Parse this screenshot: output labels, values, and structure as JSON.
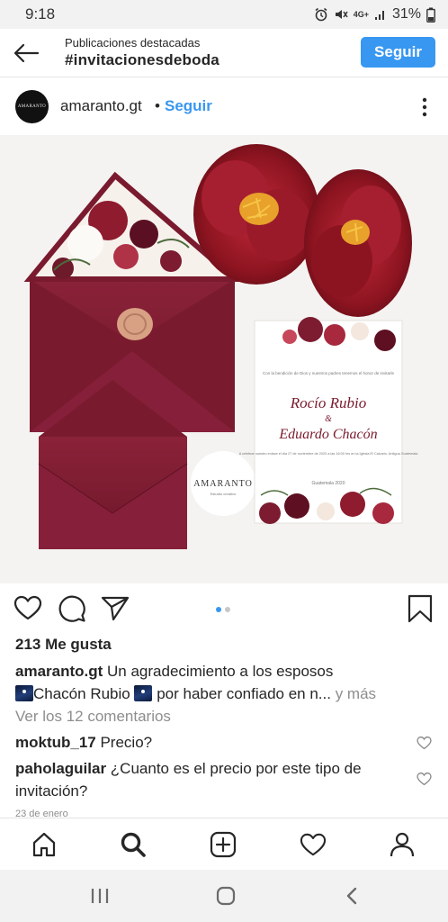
{
  "status_bar": {
    "time": "9:18",
    "network": "4G+",
    "battery": "31%",
    "icons": [
      "alarm-icon",
      "mute-icon",
      "signal-icon",
      "battery-icon"
    ]
  },
  "header": {
    "subtitle": "Publicaciones destacadas",
    "title": "#invitacionesdeboda",
    "follow_label": "Seguir"
  },
  "post": {
    "avatar_text": "AMARANTO",
    "username": "amaranto.gt",
    "separator": "•",
    "follow_label": "Seguir",
    "image": {
      "brand": "AMARANTO",
      "brand_sub": "Estudio creativo",
      "card_intro": "Con la bendición de Dios y nuestros padres tenemos el honor de invitarle",
      "name1": "Rocío Rubio",
      "ampersand": "&",
      "name2": "Eduardo Chacón",
      "card_details": "A celebrar nuestro enlace el día 27 de noviembre de 2020 a las 16:00 hrs en la Iglesia El Calvario, Antigua Guatemala",
      "card_footer": "Guatemala 2020"
    }
  },
  "actions": {
    "icons": [
      "heart-icon",
      "comment-icon",
      "share-icon",
      "bookmark-icon"
    ],
    "carousel": {
      "count": 2,
      "active": 1
    }
  },
  "likes": "213 Me gusta",
  "caption": {
    "username": "amaranto.gt",
    "text1": " Un agradecimiento a los esposos",
    "text2": "Chacón Rubio",
    "text3": " por haber confiado en n...",
    "more": " y más"
  },
  "view_comments": "Ver los 12 comentarios",
  "comments": [
    {
      "username": "moktub_17",
      "text": " Precio?"
    },
    {
      "username": "paholaguilar",
      "text": " ¿Cuanto es el precio por este tipo de invitación?"
    }
  ],
  "date": "23 de enero",
  "colors": {
    "accent": "#3897f0",
    "burgundy": "#7a1a2e",
    "flower": "#8c1420"
  }
}
